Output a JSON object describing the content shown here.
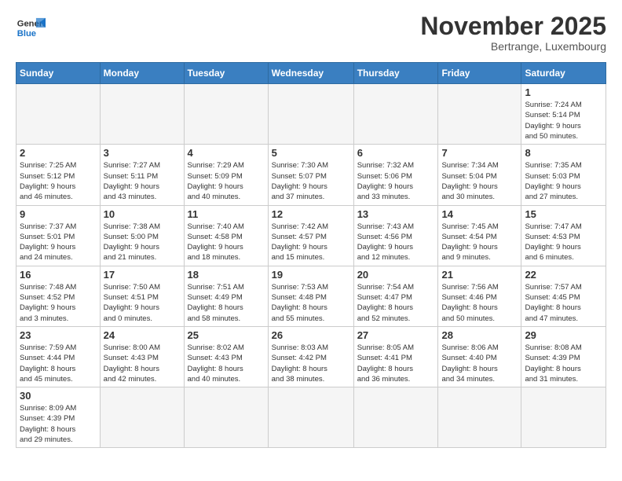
{
  "header": {
    "logo": {
      "general": "General",
      "blue": "Blue"
    },
    "title": "November 2025",
    "subtitle": "Bertrange, Luxembourg"
  },
  "weekdays": [
    "Sunday",
    "Monday",
    "Tuesday",
    "Wednesday",
    "Thursday",
    "Friday",
    "Saturday"
  ],
  "weeks": [
    [
      {
        "day": "",
        "info": ""
      },
      {
        "day": "",
        "info": ""
      },
      {
        "day": "",
        "info": ""
      },
      {
        "day": "",
        "info": ""
      },
      {
        "day": "",
        "info": ""
      },
      {
        "day": "",
        "info": ""
      },
      {
        "day": "1",
        "info": "Sunrise: 7:24 AM\nSunset: 5:14 PM\nDaylight: 9 hours\nand 50 minutes."
      }
    ],
    [
      {
        "day": "2",
        "info": "Sunrise: 7:25 AM\nSunset: 5:12 PM\nDaylight: 9 hours\nand 46 minutes."
      },
      {
        "day": "3",
        "info": "Sunrise: 7:27 AM\nSunset: 5:11 PM\nDaylight: 9 hours\nand 43 minutes."
      },
      {
        "day": "4",
        "info": "Sunrise: 7:29 AM\nSunset: 5:09 PM\nDaylight: 9 hours\nand 40 minutes."
      },
      {
        "day": "5",
        "info": "Sunrise: 7:30 AM\nSunset: 5:07 PM\nDaylight: 9 hours\nand 37 minutes."
      },
      {
        "day": "6",
        "info": "Sunrise: 7:32 AM\nSunset: 5:06 PM\nDaylight: 9 hours\nand 33 minutes."
      },
      {
        "day": "7",
        "info": "Sunrise: 7:34 AM\nSunset: 5:04 PM\nDaylight: 9 hours\nand 30 minutes."
      },
      {
        "day": "8",
        "info": "Sunrise: 7:35 AM\nSunset: 5:03 PM\nDaylight: 9 hours\nand 27 minutes."
      }
    ],
    [
      {
        "day": "9",
        "info": "Sunrise: 7:37 AM\nSunset: 5:01 PM\nDaylight: 9 hours\nand 24 minutes."
      },
      {
        "day": "10",
        "info": "Sunrise: 7:38 AM\nSunset: 5:00 PM\nDaylight: 9 hours\nand 21 minutes."
      },
      {
        "day": "11",
        "info": "Sunrise: 7:40 AM\nSunset: 4:58 PM\nDaylight: 9 hours\nand 18 minutes."
      },
      {
        "day": "12",
        "info": "Sunrise: 7:42 AM\nSunset: 4:57 PM\nDaylight: 9 hours\nand 15 minutes."
      },
      {
        "day": "13",
        "info": "Sunrise: 7:43 AM\nSunset: 4:56 PM\nDaylight: 9 hours\nand 12 minutes."
      },
      {
        "day": "14",
        "info": "Sunrise: 7:45 AM\nSunset: 4:54 PM\nDaylight: 9 hours\nand 9 minutes."
      },
      {
        "day": "15",
        "info": "Sunrise: 7:47 AM\nSunset: 4:53 PM\nDaylight: 9 hours\nand 6 minutes."
      }
    ],
    [
      {
        "day": "16",
        "info": "Sunrise: 7:48 AM\nSunset: 4:52 PM\nDaylight: 9 hours\nand 3 minutes."
      },
      {
        "day": "17",
        "info": "Sunrise: 7:50 AM\nSunset: 4:51 PM\nDaylight: 9 hours\nand 0 minutes."
      },
      {
        "day": "18",
        "info": "Sunrise: 7:51 AM\nSunset: 4:49 PM\nDaylight: 8 hours\nand 58 minutes."
      },
      {
        "day": "19",
        "info": "Sunrise: 7:53 AM\nSunset: 4:48 PM\nDaylight: 8 hours\nand 55 minutes."
      },
      {
        "day": "20",
        "info": "Sunrise: 7:54 AM\nSunset: 4:47 PM\nDaylight: 8 hours\nand 52 minutes."
      },
      {
        "day": "21",
        "info": "Sunrise: 7:56 AM\nSunset: 4:46 PM\nDaylight: 8 hours\nand 50 minutes."
      },
      {
        "day": "22",
        "info": "Sunrise: 7:57 AM\nSunset: 4:45 PM\nDaylight: 8 hours\nand 47 minutes."
      }
    ],
    [
      {
        "day": "23",
        "info": "Sunrise: 7:59 AM\nSunset: 4:44 PM\nDaylight: 8 hours\nand 45 minutes."
      },
      {
        "day": "24",
        "info": "Sunrise: 8:00 AM\nSunset: 4:43 PM\nDaylight: 8 hours\nand 42 minutes."
      },
      {
        "day": "25",
        "info": "Sunrise: 8:02 AM\nSunset: 4:43 PM\nDaylight: 8 hours\nand 40 minutes."
      },
      {
        "day": "26",
        "info": "Sunrise: 8:03 AM\nSunset: 4:42 PM\nDaylight: 8 hours\nand 38 minutes."
      },
      {
        "day": "27",
        "info": "Sunrise: 8:05 AM\nSunset: 4:41 PM\nDaylight: 8 hours\nand 36 minutes."
      },
      {
        "day": "28",
        "info": "Sunrise: 8:06 AM\nSunset: 4:40 PM\nDaylight: 8 hours\nand 34 minutes."
      },
      {
        "day": "29",
        "info": "Sunrise: 8:08 AM\nSunset: 4:39 PM\nDaylight: 8 hours\nand 31 minutes."
      }
    ],
    [
      {
        "day": "30",
        "info": "Sunrise: 8:09 AM\nSunset: 4:39 PM\nDaylight: 8 hours\nand 29 minutes."
      },
      {
        "day": "",
        "info": ""
      },
      {
        "day": "",
        "info": ""
      },
      {
        "day": "",
        "info": ""
      },
      {
        "day": "",
        "info": ""
      },
      {
        "day": "",
        "info": ""
      },
      {
        "day": "",
        "info": ""
      }
    ]
  ]
}
